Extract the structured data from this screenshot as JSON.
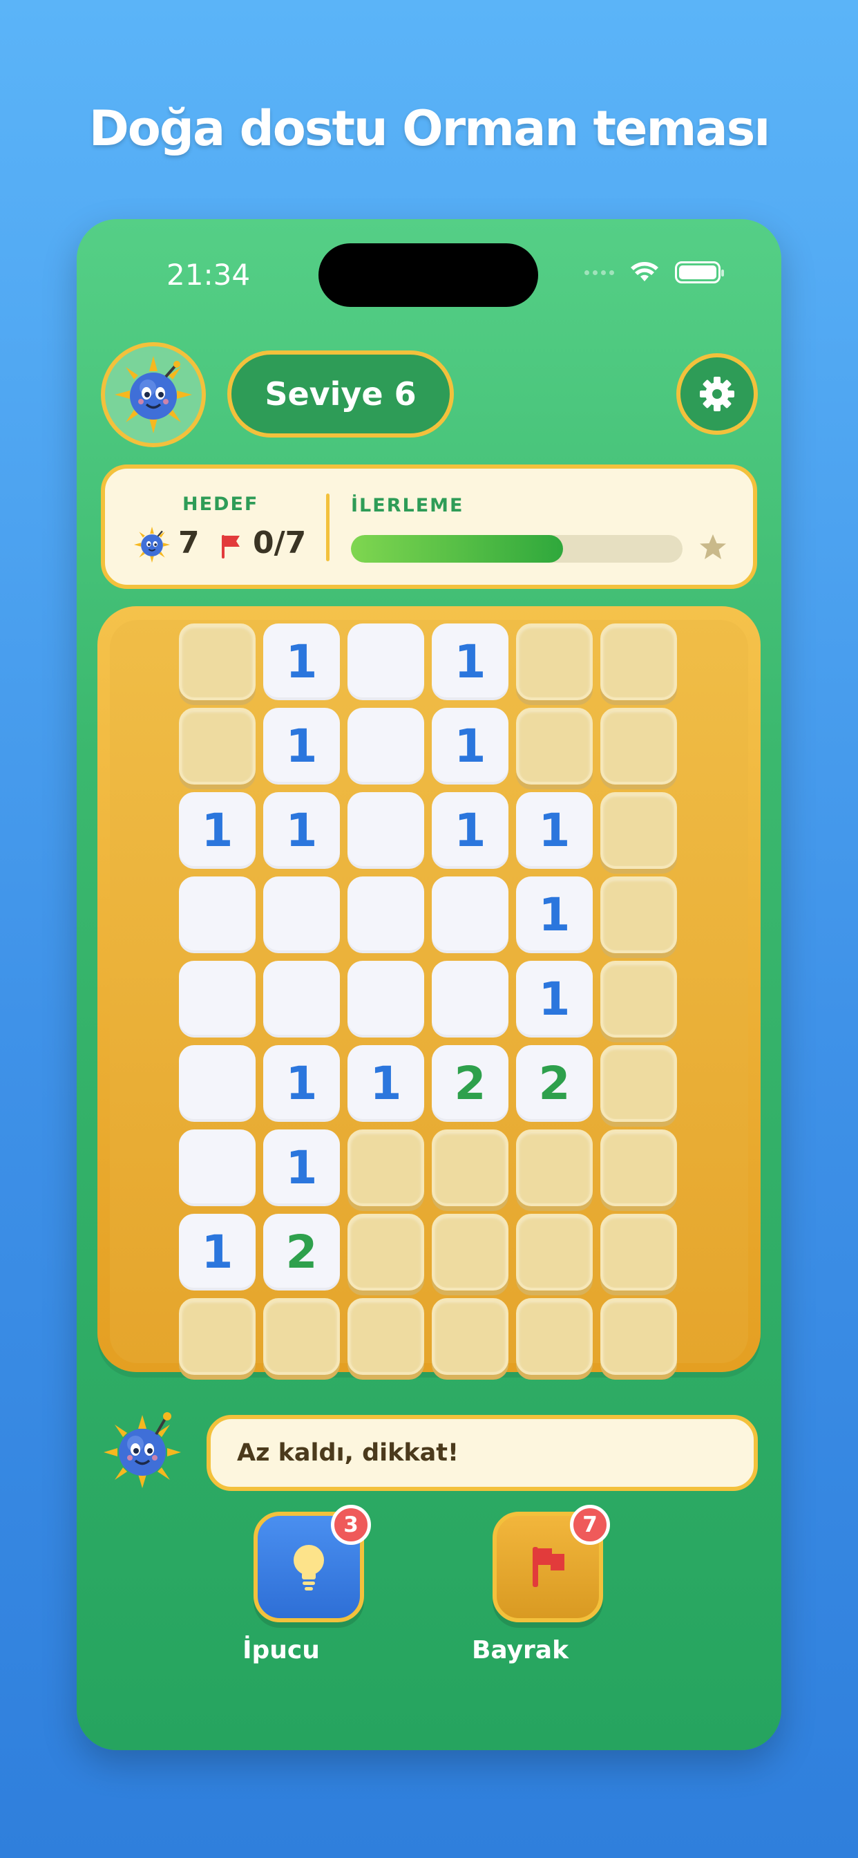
{
  "promo": {
    "title": "Doğa dostu Orman teması"
  },
  "status_bar": {
    "time": "21:34"
  },
  "header": {
    "level_label": "Seviye 6"
  },
  "stats": {
    "target_label": "HEDEF",
    "mine_count": "7",
    "flags_text": "0/7",
    "progress_label": "İLERLEME",
    "progress_fraction": 0.64
  },
  "board": {
    "rows": [
      [
        "",
        "1",
        " ",
        "1",
        "",
        ""
      ],
      [
        "",
        "1",
        " ",
        "1",
        "",
        ""
      ],
      [
        "1",
        "1",
        " ",
        "1",
        "1",
        ""
      ],
      [
        " ",
        " ",
        " ",
        " ",
        "1",
        ""
      ],
      [
        " ",
        " ",
        " ",
        " ",
        "1",
        ""
      ],
      [
        " ",
        "1",
        "1",
        "2",
        "2",
        ""
      ],
      [
        " ",
        "1",
        "",
        "",
        "",
        ""
      ],
      [
        "1",
        "2",
        "",
        "",
        "",
        ""
      ],
      [
        "",
        "",
        "",
        "",
        "",
        ""
      ]
    ]
  },
  "message": {
    "text": "Az kaldı, dikkat!"
  },
  "actions": {
    "hint_label": "İpucu",
    "hint_count": "3",
    "flag_label": "Bayrak",
    "flag_count": "7"
  },
  "colors": {
    "accent_gold": "#f3c13c",
    "primary_green": "#2e9c57",
    "number_one": "#2b76dd",
    "number_two": "#2ea04c",
    "badge_red": "#ef5a5a"
  }
}
